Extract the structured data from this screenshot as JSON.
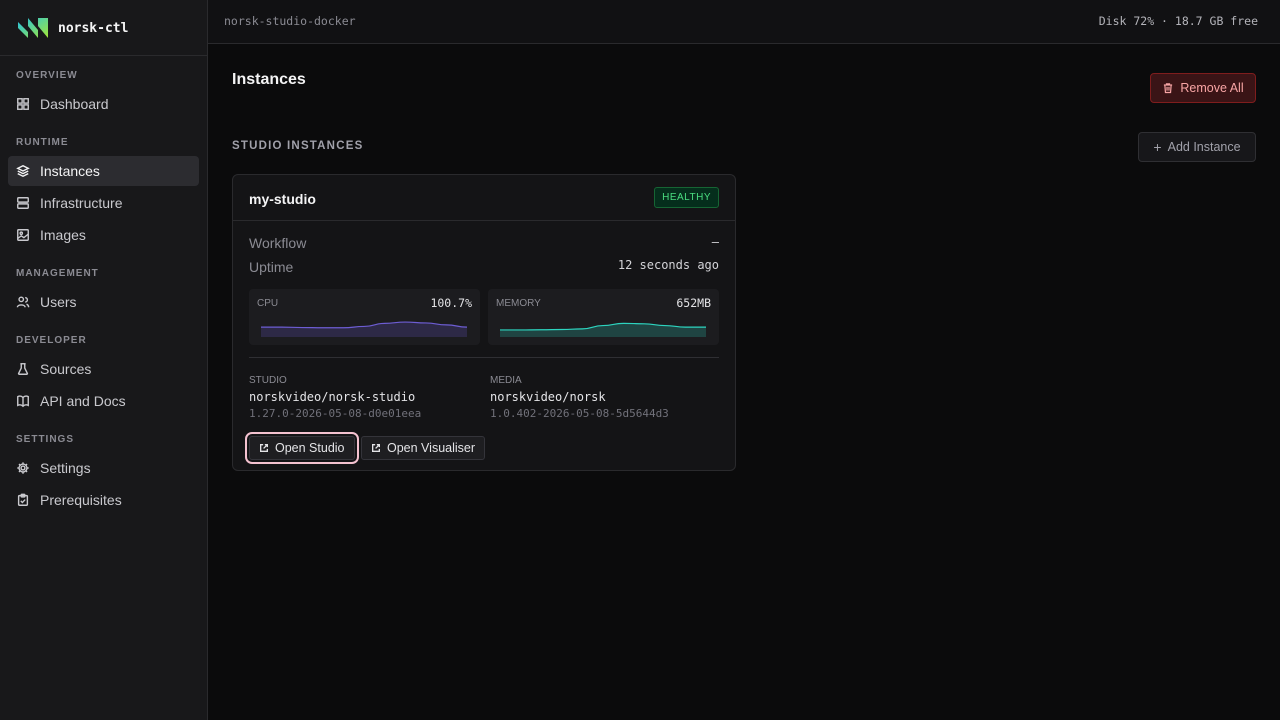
{
  "app": {
    "name": "norsk-ctl"
  },
  "topbar": {
    "context": "norsk-studio-docker",
    "disk": "Disk 72% · 18.7 GB free"
  },
  "sidebar": {
    "sections": [
      {
        "label": "Overview",
        "items": [
          {
            "label": "Dashboard",
            "icon": "grid-icon"
          }
        ]
      },
      {
        "label": "Runtime",
        "items": [
          {
            "label": "Instances",
            "icon": "layers-icon",
            "active": true
          },
          {
            "label": "Infrastructure",
            "icon": "server-icon"
          },
          {
            "label": "Images",
            "icon": "image-icon"
          }
        ]
      },
      {
        "label": "Management",
        "items": [
          {
            "label": "Users",
            "icon": "users-icon"
          }
        ]
      },
      {
        "label": "Developer",
        "items": [
          {
            "label": "Sources",
            "icon": "flask-icon"
          },
          {
            "label": "API and Docs",
            "icon": "book-icon"
          }
        ]
      },
      {
        "label": "Settings",
        "items": [
          {
            "label": "Settings",
            "icon": "gear-icon"
          },
          {
            "label": "Prerequisites",
            "icon": "clipboard-check-icon"
          }
        ]
      }
    ]
  },
  "main": {
    "title": "Instances",
    "remove_all_label": "Remove All",
    "section_title": "Studio Instances",
    "add_instance_label": "Add Instance",
    "instance": {
      "name": "my-studio",
      "status": "HEALTHY",
      "status_color": "#4ade80",
      "workflow_label": "Workflow",
      "workflow_value": "–",
      "uptime_label": "Uptime",
      "uptime_value": "12 seconds ago",
      "cpu": {
        "label": "CPU",
        "value": "100.7%",
        "color": "#6d5dd3",
        "spark": [
          0.45,
          0.45,
          0.43,
          0.42,
          0.42,
          0.48,
          0.62,
          0.68,
          0.64,
          0.55,
          0.45
        ]
      },
      "memory": {
        "label": "Memory",
        "value": "652MB",
        "color": "#2dd4bf",
        "spark": [
          0.32,
          0.32,
          0.33,
          0.34,
          0.37,
          0.52,
          0.62,
          0.6,
          0.52,
          0.45,
          0.45
        ]
      },
      "studio": {
        "label": "Studio",
        "repo": "norskvideo/norsk-studio",
        "tag": "1.27.0-2026-05-08-d0e01eea"
      },
      "media": {
        "label": "Media",
        "repo": "norskvideo/norsk",
        "tag": "1.0.402-2026-05-08-5d5644d3"
      },
      "open_studio_label": "Open Studio",
      "open_visualiser_label": "Open Visualiser"
    }
  }
}
